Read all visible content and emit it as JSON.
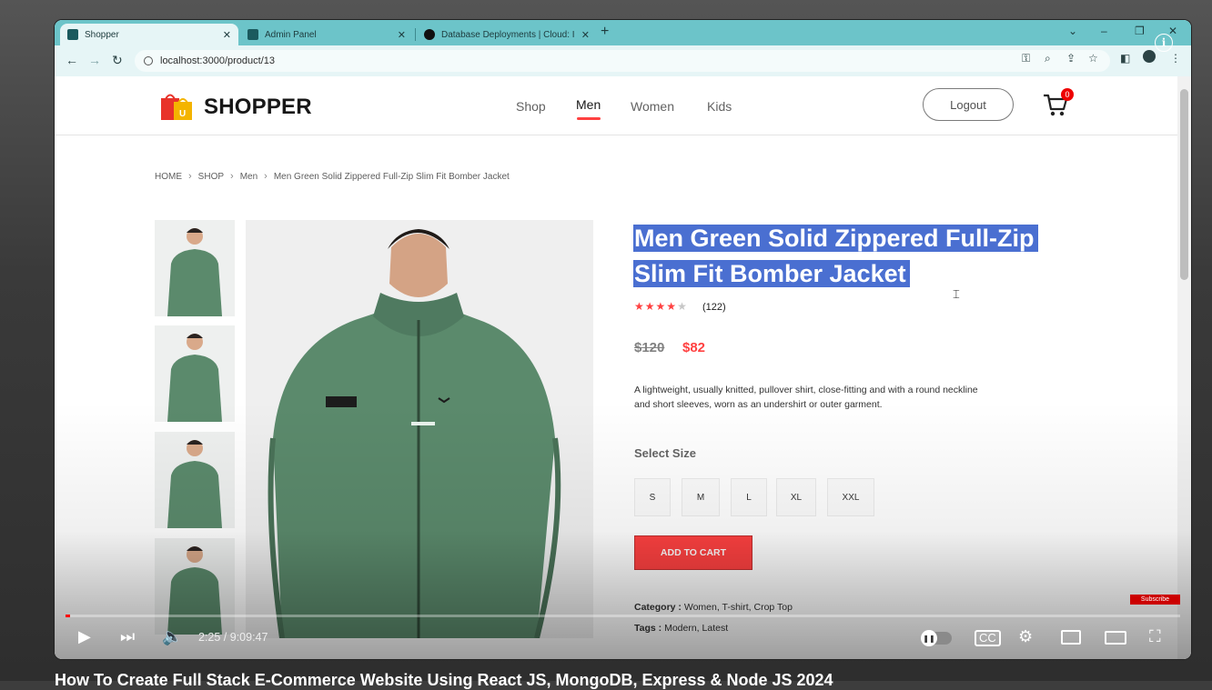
{
  "browser": {
    "tabs": [
      {
        "title": "Shopper",
        "close": "✕"
      },
      {
        "title": "Admin Panel",
        "close": "✕"
      },
      {
        "title": "Database Deployments | Cloud: I",
        "close": "✕"
      }
    ],
    "new_tab": "+",
    "url": "localhost:3000/product/13"
  },
  "site": {
    "logo_text": "SHOPPER",
    "menu": [
      "Shop",
      "Men",
      "Women",
      "Kids"
    ],
    "active_menu": "Men",
    "logout_label": "Logout",
    "cart_count": "0"
  },
  "breadcrumb": [
    "HOME",
    "SHOP",
    "Men",
    "Men Green Solid Zippered Full-Zip Slim Fit Bomber Jacket"
  ],
  "product": {
    "title_line1": "Men Green Solid Zippered Full-Zip",
    "title_line2": "Slim Fit Bomber Jacket",
    "rating": 4,
    "rating_max": 5,
    "reviews": "(122)",
    "old_price": "$120",
    "new_price": "$82",
    "description_line1": "A lightweight, usually knitted, pullover shirt, close-fitting and with a round neckline",
    "description_line2": "and short sleeves, worn as an undershirt or outer garment.",
    "size_label": "Select Size",
    "sizes": [
      "S",
      "M",
      "L",
      "XL",
      "XXL"
    ],
    "add_to_cart": "ADD TO CART",
    "category_label": "Category :",
    "category_value": "Women, T-shirt, Crop Top",
    "tags_label": "Tags :",
    "tags_value": "Modern, Latest"
  },
  "video": {
    "time": "2:25 / 9:09:47",
    "progress": 0.0044,
    "subscribe": "Subscribe",
    "info": "i",
    "title": "How To Create Full Stack E-Commerce Website Using React JS, MongoDB, Express & Node JS 2024"
  },
  "colors": {
    "browser_tab_bar": "#6cc4c9",
    "accent_red": "#ff4141",
    "selection_blue": "#4a6fd1",
    "jacket_green": "#5b8a6c"
  }
}
